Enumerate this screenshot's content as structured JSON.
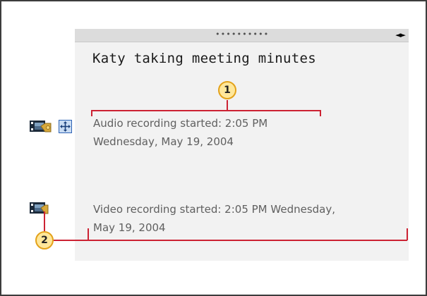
{
  "note": {
    "title": "Katy taking meeting minutes",
    "drag_handle": "••••••••••",
    "resize_arrows": "◄►",
    "audio_line1": "Audio recording started: 2:05 PM",
    "audio_line2": "Wednesday, May 19, 2004",
    "video_line1": "Video recording started: 2:05 PM Wednesday,",
    "video_line2": "May 19, 2004"
  },
  "callouts": {
    "one": "1",
    "two": "2"
  },
  "icons": {
    "audio": "audio-recording-icon",
    "move": "move-handle-icon",
    "video": "video-recording-icon"
  },
  "colors": {
    "callout_line": "#cc2233",
    "callout_fill": "#ffe79a",
    "callout_border": "#e3a21a",
    "note_background": "#f2f2f2",
    "text_gray": "#606060"
  }
}
